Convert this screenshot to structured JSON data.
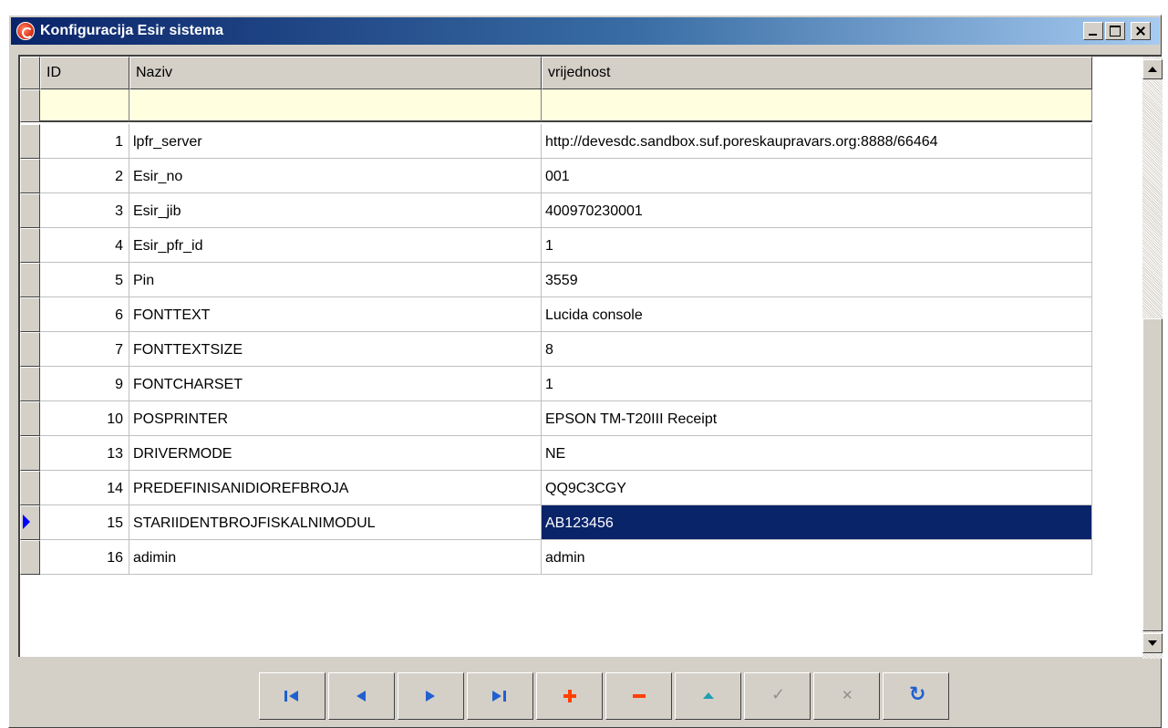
{
  "window": {
    "title": "Konfiguracija Esir sistema"
  },
  "grid": {
    "columns": [
      "ID",
      "Naziv",
      "vrijednost"
    ],
    "selected_row_index": 11,
    "rows": [
      {
        "id": "1",
        "naziv": "lpfr_server",
        "vrijednost": "http://devesdc.sandbox.suf.poreskaupravars.org:8888/66464"
      },
      {
        "id": "2",
        "naziv": "Esir_no",
        "vrijednost": "001"
      },
      {
        "id": "3",
        "naziv": "Esir_jib",
        "vrijednost": "400970230001"
      },
      {
        "id": "4",
        "naziv": "Esir_pfr_id",
        "vrijednost": "1"
      },
      {
        "id": "5",
        "naziv": "Pin",
        "vrijednost": "3559"
      },
      {
        "id": "6",
        "naziv": "FONTTEXT",
        "vrijednost": "Lucida console"
      },
      {
        "id": "7",
        "naziv": "FONTTEXTSIZE",
        "vrijednost": "8"
      },
      {
        "id": "9",
        "naziv": "FONTCHARSET",
        "vrijednost": "1"
      },
      {
        "id": "10",
        "naziv": "POSPRINTER",
        "vrijednost": "EPSON TM-T20III Receipt"
      },
      {
        "id": "13",
        "naziv": "DRIVERMODE",
        "vrijednost": "NE"
      },
      {
        "id": "14",
        "naziv": "PREDEFINISANIDIOREFBROJA",
        "vrijednost": "QQ9C3CGY"
      },
      {
        "id": "15",
        "naziv": "STARIIDENTBROJFISKALNIMODUL",
        "vrijednost": "AB123456"
      },
      {
        "id": "16",
        "naziv": "adimin",
        "vrijednost": "admin"
      }
    ]
  },
  "navigator": {
    "buttons": [
      {
        "name": "first-record-button",
        "icon": "first-icon"
      },
      {
        "name": "prior-record-button",
        "icon": "prev-icon"
      },
      {
        "name": "next-record-button",
        "icon": "next-icon"
      },
      {
        "name": "last-record-button",
        "icon": "last-icon"
      },
      {
        "name": "insert-record-button",
        "icon": "plus-icon"
      },
      {
        "name": "delete-record-button",
        "icon": "minus-icon"
      },
      {
        "name": "edit-record-button",
        "icon": "up-icon"
      },
      {
        "name": "post-record-button",
        "icon": "check-icon"
      },
      {
        "name": "cancel-record-button",
        "icon": "cancel-icon"
      },
      {
        "name": "refresh-record-button",
        "icon": "refresh-icon"
      }
    ]
  }
}
